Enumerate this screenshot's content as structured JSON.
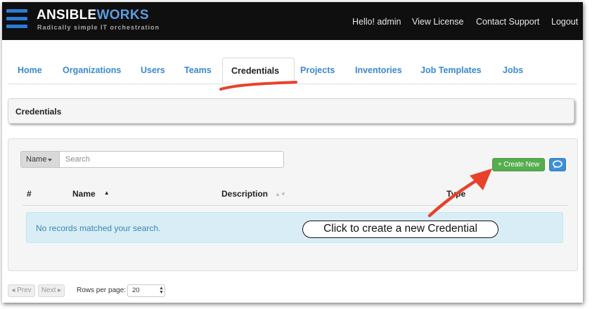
{
  "header": {
    "logo_part1": "ANSIBLE",
    "logo_part2": "WORKS",
    "tagline": "Radically simple IT orchestration",
    "greeting": "Hello! admin",
    "links": [
      "View License",
      "Contact Support",
      "Logout"
    ]
  },
  "tabs": [
    "Home",
    "Organizations",
    "Users",
    "Teams",
    "Credentials",
    "Projects",
    "Inventories",
    "Job Templates",
    "Jobs"
  ],
  "active_tab": "Credentials",
  "breadcrumb": {
    "title": "Credentials"
  },
  "search": {
    "field_label": "Name",
    "placeholder": "Search"
  },
  "buttons": {
    "create_new": "+ Create New",
    "chat_icon": "chat-icon"
  },
  "table": {
    "columns": [
      "#",
      "Name",
      "Description",
      "Type"
    ],
    "empty_message": "No records matched your search."
  },
  "annotation": {
    "text": "Click to create a new Credential"
  },
  "pagination": {
    "prev": "◂ Prev",
    "next": "Next ▸",
    "rows_label": "Rows per page:",
    "rows_value": "20"
  },
  "colors": {
    "topbar": "#0f0f10",
    "link": "#3a88d0",
    "create_button": "#55ad4d",
    "info_row": "#d9edf7",
    "annotation_red": "#e8422b"
  }
}
